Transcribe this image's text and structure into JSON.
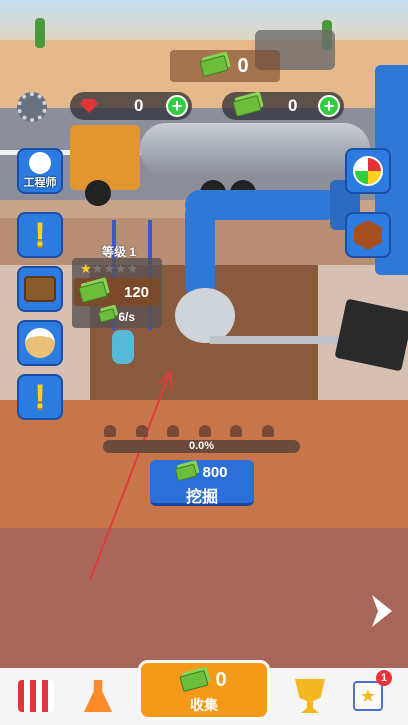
{
  "top": {
    "cash_display": "0",
    "gems": "0",
    "cash": "0",
    "plus_label": "+"
  },
  "sidebar": {
    "engineer_label": "工程师",
    "alert_glyph": "!"
  },
  "station": {
    "level_label": "等级 1",
    "stars_filled": 1,
    "stars_total": 5,
    "upgrade_cost": "120",
    "rate": "6/s"
  },
  "dig": {
    "progress_text": "0.0%",
    "progress_value": 0,
    "cost": "800",
    "button_label": "挖掘"
  },
  "bottom": {
    "collect_amount": "0",
    "collect_label": "收集",
    "calendar_badge": "1"
  },
  "colors": {
    "accent_orange": "#f59a18",
    "button_blue": "#2c7be0",
    "plus_green": "#2fcf3f",
    "gem_red": "#e5333a"
  }
}
